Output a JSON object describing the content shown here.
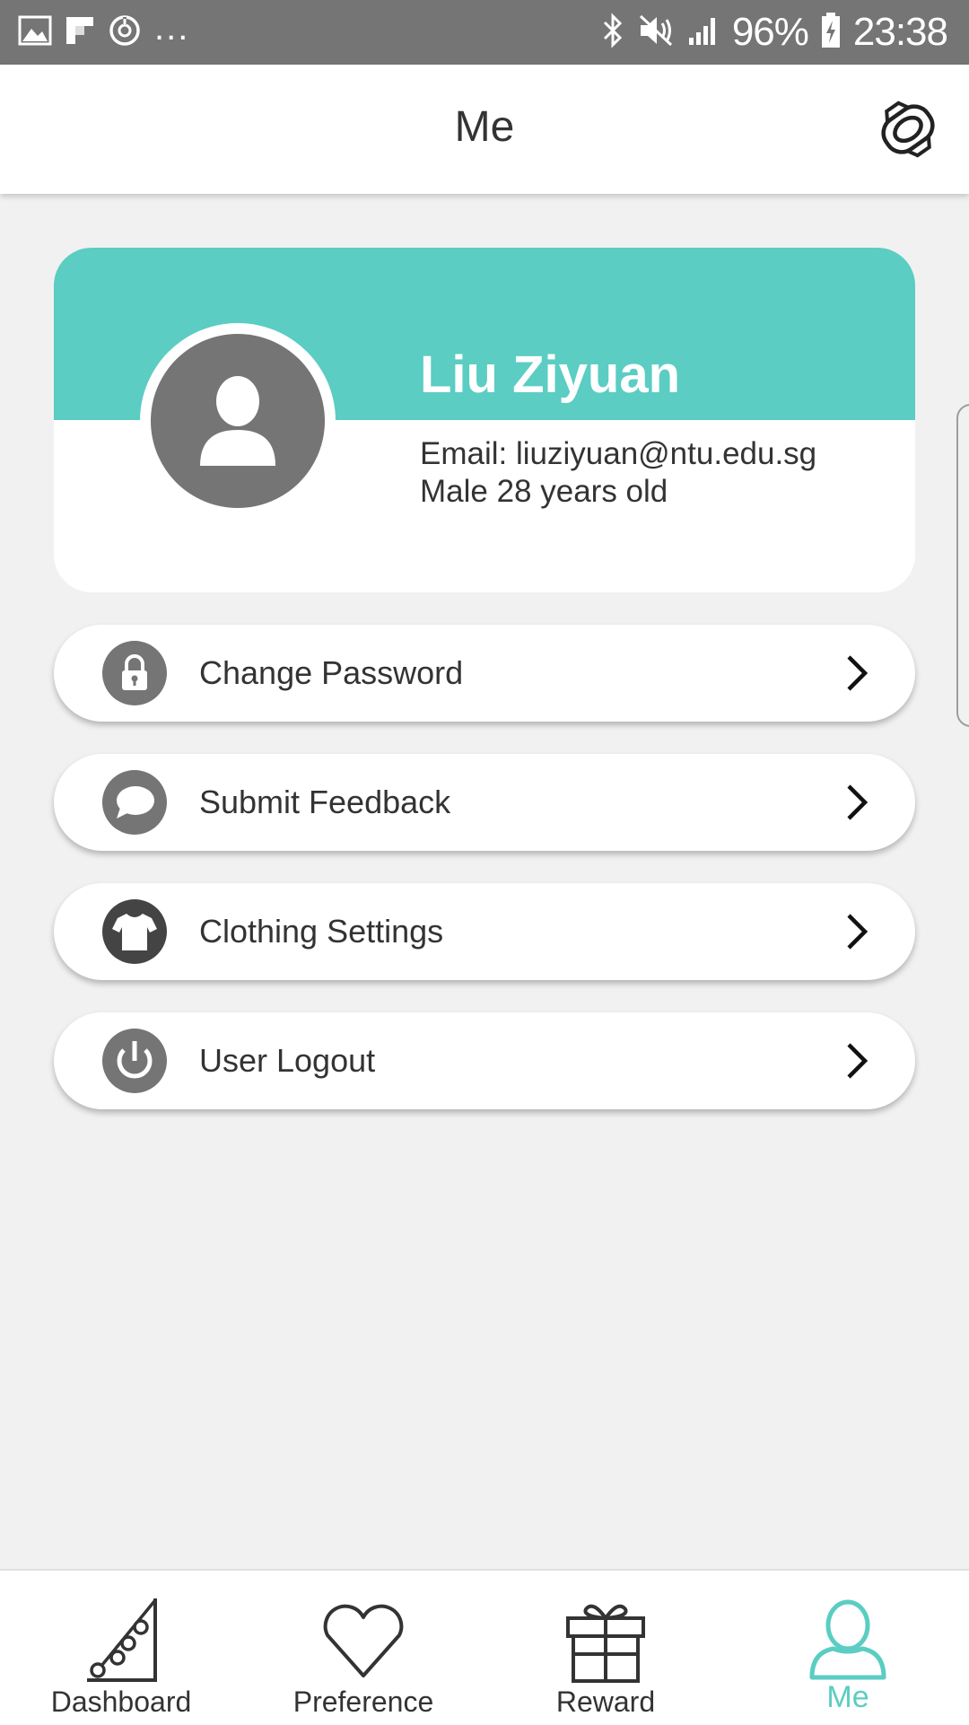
{
  "status_bar": {
    "battery": "96%",
    "time": "23:38",
    "more": "..."
  },
  "header": {
    "title": "Me"
  },
  "profile": {
    "name": "Liu Ziyuan",
    "email": "Email: liuziyuan@ntu.edu.sg",
    "info": "Male 28 years old"
  },
  "menu": {
    "items": [
      {
        "label": "Change Password",
        "icon": "lock-icon"
      },
      {
        "label": "Submit Feedback",
        "icon": "chat-bubble-icon"
      },
      {
        "label": "Clothing Settings",
        "icon": "shirt-icon"
      },
      {
        "label": "User Logout",
        "icon": "power-icon"
      }
    ]
  },
  "bottom_nav": {
    "items": [
      {
        "label": "Dashboard",
        "icon": "chart-icon"
      },
      {
        "label": "Preference",
        "icon": "heart-icon"
      },
      {
        "label": "Reward",
        "icon": "gift-icon"
      },
      {
        "label": "Me",
        "icon": "person-icon",
        "active": true
      }
    ]
  },
  "colors": {
    "accent": "#5bcdc3",
    "icon_gray": "#757575",
    "status_bar": "#757575"
  }
}
